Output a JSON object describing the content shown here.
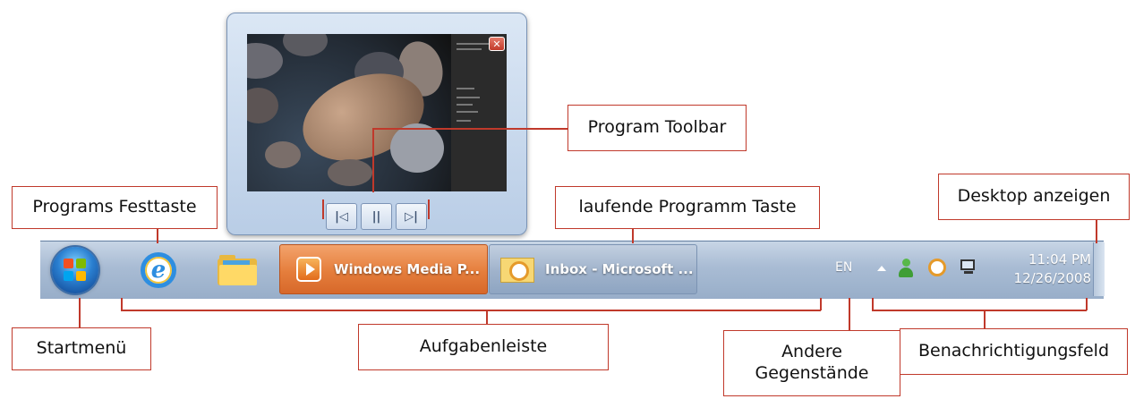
{
  "callouts": {
    "program_toolbar": "Program Toolbar",
    "programs_festtaste": "Programs Festtaste",
    "laufende_programm_taste": "laufende Programm Taste",
    "desktop_anzeigen": "Desktop anzeigen",
    "startmenue": "Startmenü",
    "aufgabenleiste": "Aufgabenleiste",
    "andere_gegenstaende": "Andere\nGegenstände",
    "benachrichtigungsfeld": "Benachrichtigungsfeld"
  },
  "taskbar": {
    "start_icon": "windows-orb-icon",
    "pinned": [
      {
        "icon": "internet-explorer-icon"
      },
      {
        "icon": "folder-icon"
      }
    ],
    "running": [
      {
        "label": "Windows Media P...",
        "icon": "media-player-icon",
        "active": true
      },
      {
        "label": "Inbox - Microsoft ...",
        "icon": "outlook-icon",
        "active": false
      }
    ],
    "language": "EN",
    "clock": {
      "time": "11:04 PM",
      "date": "12/26/2008"
    }
  },
  "preview": {
    "close_icon": "close-icon",
    "toolbar_buttons": [
      {
        "name": "previous",
        "glyph": "|◁"
      },
      {
        "name": "pause",
        "glyph": "||"
      },
      {
        "name": "next",
        "glyph": "▷|"
      }
    ]
  },
  "colors": {
    "callout_border": "#c0392b",
    "active_task": "#e57e3c",
    "taskbar": "#a9bcd4"
  }
}
